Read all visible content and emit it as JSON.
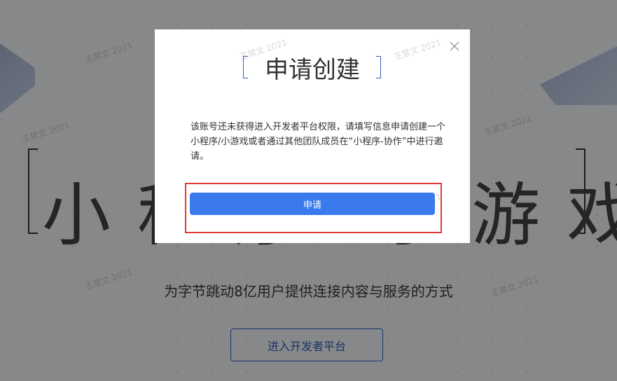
{
  "background": {
    "hero_title": "小程序·小游戏",
    "subtitle": "为字节跳动8亿用户提供连接内容与服务的方式",
    "enter_button": "进入开发者平台",
    "watermark": "王禁文 2021"
  },
  "modal": {
    "title": "申请创建",
    "description": "该账号还未获得进入开发者平台权限，请填写信息申请创建一个小程序/小游戏或者通过其他团队成员在“小程序-协作”中进行邀请。",
    "apply_button": "申请",
    "close_icon": "close-icon",
    "watermark": "王禁文 2021"
  },
  "colors": {
    "primary": "#3a7aee",
    "accent_bracket": "#2f62c8",
    "annotation": "#e53935",
    "overlay": "rgba(0,0,0,0.45)"
  }
}
